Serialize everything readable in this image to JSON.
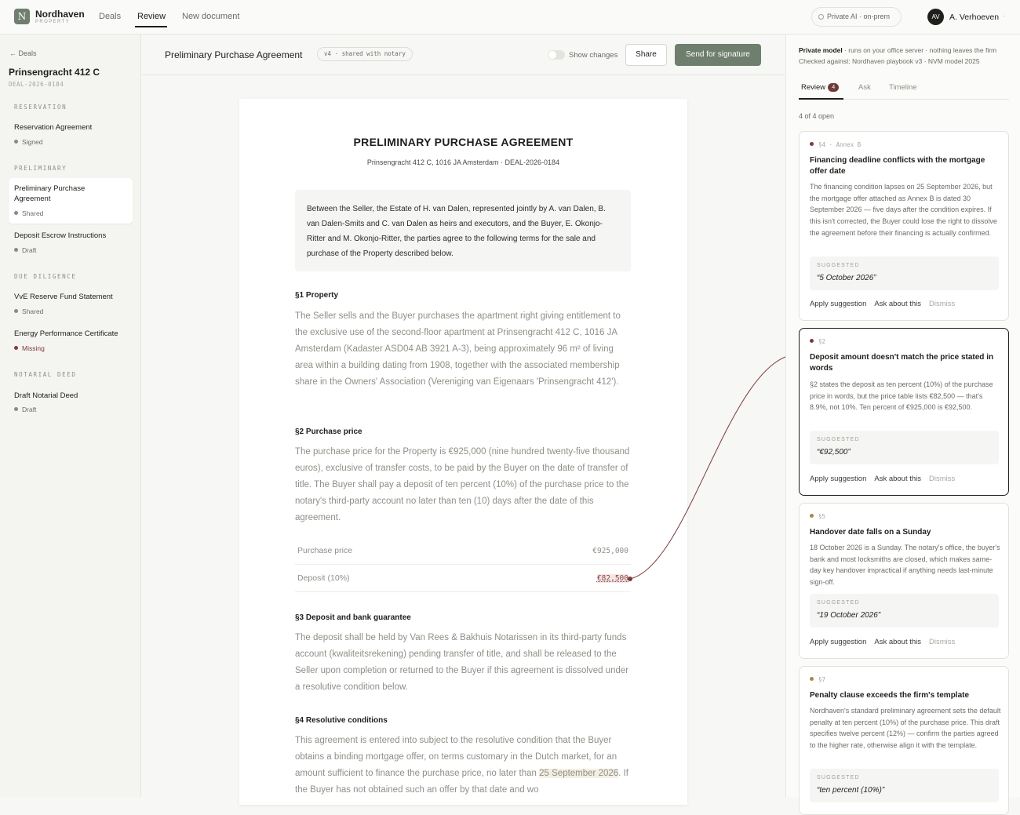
{
  "app": {
    "brand": "Nordhaven",
    "brand_sub": "PROPERTY",
    "logo_letter": "N",
    "nav": [
      "Deals",
      "Review",
      "New document"
    ],
    "private_ai": "Private AI · on-prem",
    "user_initials": "AV",
    "user_name": "A. Verhoeven"
  },
  "sidebar": {
    "back": "← Deals",
    "property": "Prinsengracht 412 C",
    "deal_id": "DEAL-2026-0184",
    "sections": [
      {
        "title": "RESERVATION",
        "docs": [
          {
            "name": "Reservation Agreement",
            "status": "Signed"
          }
        ]
      },
      {
        "title": "PRELIMINARY",
        "docs": [
          {
            "name": "Preliminary Purchase Agreement",
            "status": "Shared"
          },
          {
            "name": "Deposit Escrow Instructions",
            "status": "Draft"
          }
        ]
      },
      {
        "title": "DUE DILIGENCE",
        "docs": [
          {
            "name": "VvE Reserve Fund Statement",
            "status": "Shared"
          },
          {
            "name": "Energy Performance Certificate",
            "status": "Missing"
          }
        ]
      },
      {
        "title": "NOTARIAL DEED",
        "docs": [
          {
            "name": "Draft Notarial Deed",
            "status": "Draft"
          }
        ]
      }
    ]
  },
  "docbar": {
    "title": "Preliminary Purchase Agreement",
    "version": "v4 · shared with notary",
    "show_changes": "Show changes",
    "share": "Share",
    "send": "Send for signature"
  },
  "document": {
    "title": "PRELIMINARY PURCHASE AGREEMENT",
    "subtitle": "Prinsengracht 412 C, 1016 JA Amsterdam · DEAL-2026-0184",
    "preamble": "Between the Seller, the Estate of H. van Dalen, represented jointly by A. van Dalen, B. van Dalen-Smits and C. van Dalen as heirs and executors, and the Buyer, E. Okonjo-Ritter and M. Okonjo-Ritter, the parties agree to the following terms for the sale and purchase of the Property described below.",
    "s1_heading": "§1 Property",
    "s1_text": "The Seller sells and the Buyer purchases the apartment right giving entitlement to the exclusive use of the second-floor apartment at Prinsengracht 412 C, 1016 JA Amsterdam (Kadaster ASD04 AB 3921 A-3), being approximately 96 m² of living area within a building dating from 1908, together with the associated membership share in the Owners' Association (Vereniging van Eigenaars 'Prinsengracht 412').",
    "s2_heading": "§2 Purchase price",
    "s2_text": "The purchase price for the Property is €925,000 (nine hundred twenty-five thousand euros), exclusive of transfer costs, to be paid by the Buyer on the date of transfer of title. The Buyer shall pay a deposit of ten percent (10%) of the purchase price to the notary's third-party account no later than ten (10) days after the date of this agreement.",
    "price_table": [
      {
        "label": "Purchase price",
        "value": "€925,000"
      },
      {
        "label": "Deposit (10%)",
        "value": "€82,500"
      }
    ],
    "s3_heading": "§3 Deposit and bank guarantee",
    "s3_text": "The deposit shall be held by Van Rees & Bakhuis Notarissen in its third-party funds account (kwaliteitsrekening) pending transfer of title, and shall be released to the Seller upon completion or returned to the Buyer if this agreement is dissolved under a resolutive condition below.",
    "s4_heading": "§4 Resolutive conditions",
    "s4_text_a": "This agreement is entered into subject to the resolutive condition that the Buyer obtains a binding mortgage offer, on terms customary in the Dutch market, for an amount sufficient to finance the purchase price, no later than",
    "s4_date": "25 September 2026",
    "s4_text_b": ". If the Buyer has not obtained such an offer by that date and wo"
  },
  "review": {
    "model_line_bold": "Private model",
    "model_line_rest": " · runs on your office server · nothing leaves the firm",
    "checked_line": "Checked against: Nordhaven playbook v3 · NVM model 2025",
    "tabs": [
      "Review",
      "Ask",
      "Timeline"
    ],
    "badge": "4",
    "open_count": "4 of 4 open",
    "suggested_label": "SUGGESTED",
    "actions": [
      "Apply suggestion",
      "Ask about this",
      "Dismiss"
    ],
    "cards": [
      {
        "meta": "§4 · Annex B",
        "dot": "#7a3b3b",
        "title": "Financing deadline conflicts with the mortgage offer date",
        "body": "The financing condition lapses on 25 September 2026, but the mortgage offer attached as Annex B is dated 30 September 2026 — five days after the condition expires. If this isn't corrected, the Buyer could lose the right to dissolve the agreement before their financing is actually confirmed.",
        "suggested": "“5 October 2026”"
      },
      {
        "meta": "§2",
        "dot": "#7a3b3b",
        "title": "Deposit amount doesn't match the price stated in words",
        "body": "§2 states the deposit as ten percent (10%) of the purchase price in words, but the price table lists €82,500 — that's 8.9%, not 10%. Ten percent of €925,000 is €92,500.",
        "suggested": "“€92,500”"
      },
      {
        "meta": "§5",
        "dot": "#a8894a",
        "title": "Handover date falls on a Sunday",
        "body": "18 October 2026 is a Sunday. The notary's office, the buyer's bank and most locksmiths are closed, which makes same-day key handover impractical if anything needs last-minute sign-off.",
        "suggested": "“19 October 2026”"
      },
      {
        "meta": "§7",
        "dot": "#a8894a",
        "title": "Penalty clause exceeds the firm's template",
        "body": "Nordhaven's standard preliminary agreement sets the default penalty at ten percent (10%) of the purchase price. This draft specifies twelve percent (12%) — confirm the parties agreed to the higher rate, otherwise align it with the template.",
        "suggested": "“ten percent (10%)”"
      }
    ]
  }
}
